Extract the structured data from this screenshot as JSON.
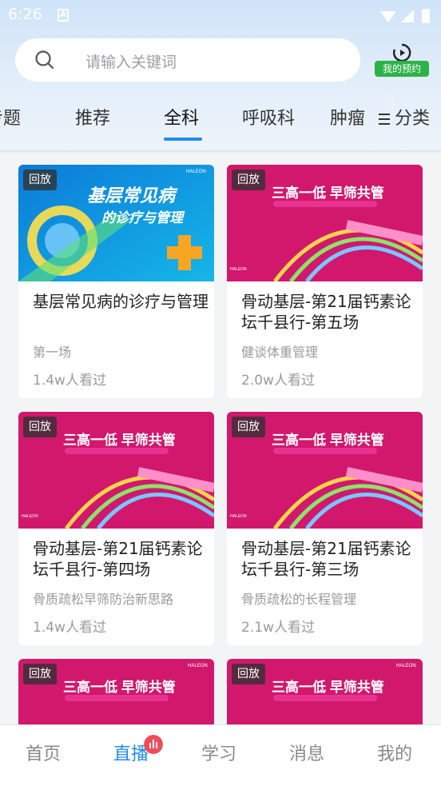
{
  "status": {
    "time": "6:26",
    "icon_a": "A"
  },
  "search": {
    "placeholder": "请输入关键词"
  },
  "booking": {
    "label": "我的预约",
    "icon": "play-clock-icon",
    "color": "#2db24a"
  },
  "tabs": [
    {
      "label": "专题"
    },
    {
      "label": "推荐"
    },
    {
      "label": "全科"
    },
    {
      "label": "呼吸科"
    },
    {
      "label": "肿瘤"
    }
  ],
  "category": {
    "label": "分类"
  },
  "accent": "#1f8ceb",
  "cards": [
    {
      "badge": "回放",
      "title": "基层常见病的诊疗与管理",
      "subtitle": "第一场",
      "views": "1.4w人看过",
      "thumb": {
        "style": "blue",
        "headline": "基层常见病",
        "subline": "的诊疗与管理",
        "brand": "HALEON"
      }
    },
    {
      "badge": "回放",
      "title": "骨动基层-第21届钙素论坛千县行-第五场",
      "subtitle": "健谈体重管理",
      "views": "2.0w人看过",
      "thumb": {
        "style": "pink",
        "headline": "三高一低 早筛共管",
        "brand": "HALEON"
      }
    },
    {
      "badge": "回放",
      "title": "骨动基层-第21届钙素论坛千县行-第四场",
      "subtitle": "骨质疏松早筛防治新思路",
      "views": "1.4w人看过",
      "thumb": {
        "style": "pink",
        "headline": "三高一低 早筛共管",
        "brand": "HALEON"
      }
    },
    {
      "badge": "回放",
      "title": "骨动基层-第21届钙素论坛千县行-第三场",
      "subtitle": "骨质疏松的长程管理",
      "views": "2.1w人看过",
      "thumb": {
        "style": "pink",
        "headline": "三高一低 早筛共管",
        "brand": "HALEON"
      }
    },
    {
      "badge": "回放",
      "thumb": {
        "style": "pink",
        "headline": "三高一低 早筛共管",
        "brand": "HALEON"
      }
    },
    {
      "badge": "回放",
      "thumb": {
        "style": "pink",
        "headline": "三高一低 早筛共管",
        "brand": "HALEON"
      }
    }
  ],
  "bottom_nav": [
    {
      "label": "首页"
    },
    {
      "label": "直播"
    },
    {
      "label": "学习"
    },
    {
      "label": "消息"
    },
    {
      "label": "我的"
    }
  ]
}
